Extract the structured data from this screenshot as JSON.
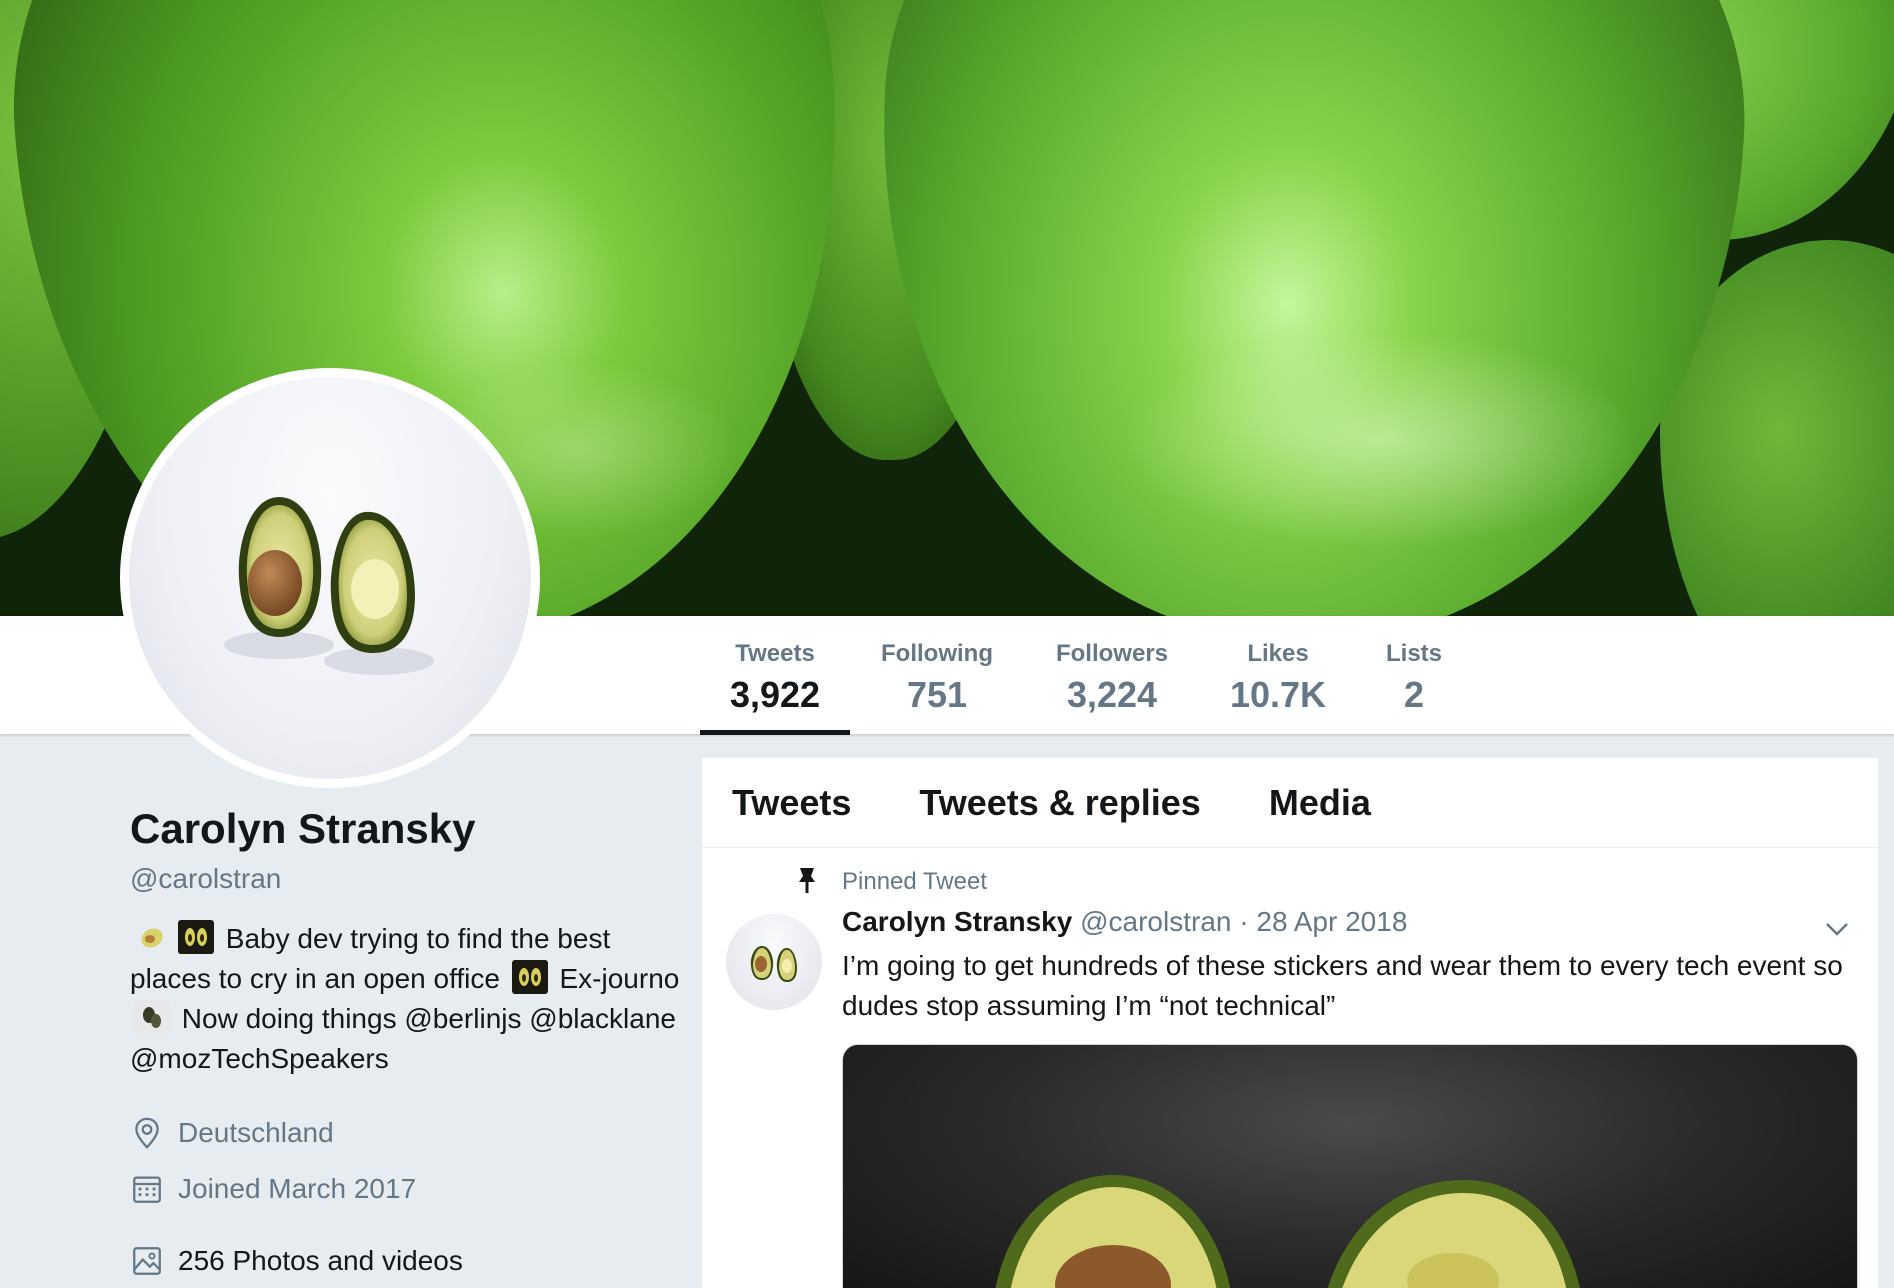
{
  "stats": [
    {
      "label": "Tweets",
      "value": "3,922",
      "active": true
    },
    {
      "label": "Following",
      "value": "751",
      "active": false
    },
    {
      "label": "Followers",
      "value": "3,224",
      "active": false
    },
    {
      "label": "Likes",
      "value": "10.7K",
      "active": false
    },
    {
      "label": "Lists",
      "value": "2",
      "active": false
    }
  ],
  "profile": {
    "name": "Carolyn Stransky",
    "handle": "@carolstran",
    "bio": {
      "part1": "Baby dev trying to find the best places to cry in an open office",
      "part2": "Ex-journo",
      "part3": "Now doing things @berlinjs @blacklane @mozTechSpeakers"
    },
    "location": "Deutschland",
    "joined": "Joined March 2017",
    "media_link": "256 Photos and videos"
  },
  "timeline": {
    "tabs": [
      "Tweets",
      "Tweets & replies",
      "Media"
    ],
    "pinned_label": "Pinned Tweet",
    "tweet": {
      "author_name": "Carolyn Stransky",
      "author_handle": "@carolstran",
      "separator": "·",
      "date": "28 Apr 2018",
      "text": "I’m going to get hundreds of these stickers and wear them to every tech event so dudes stop assuming I’m “not technical”"
    }
  },
  "colors": {
    "text_primary": "#14171a",
    "text_secondary": "#657786",
    "page_background": "#e6ecf0",
    "banner_green": "#5aa62c"
  }
}
